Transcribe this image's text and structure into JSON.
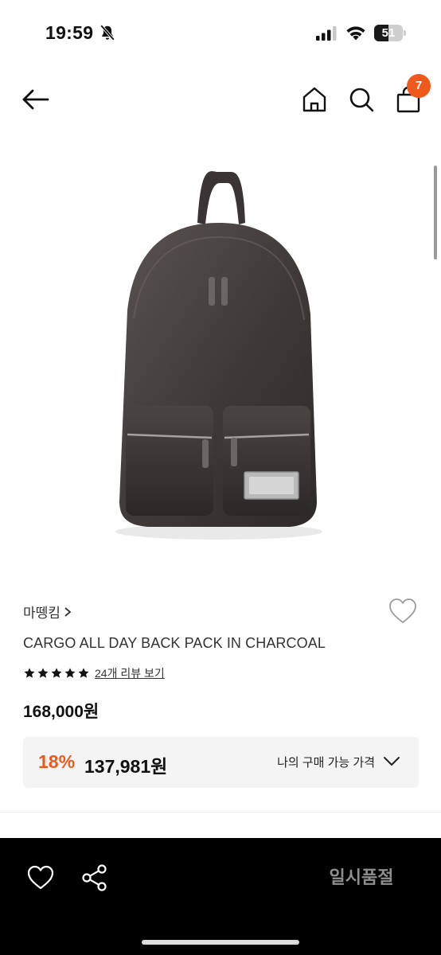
{
  "status_bar": {
    "time": "19:59",
    "battery": "51",
    "battery_level": 0.51
  },
  "nav": {
    "cart_count": "7"
  },
  "product": {
    "brand": "마뗑킴",
    "name": "CARGO ALL DAY BACK PACK IN CHARCOAL",
    "rating": 5,
    "review_link": "24개 리뷰 보기",
    "original_price": "168,000원",
    "discount_rate": "18%",
    "discount_price": "137,981원",
    "my_price_label": "나의 구매 가능 가격"
  },
  "bottom_bar": {
    "soldout_label": "일시품절"
  },
  "icons": {
    "back": "arrow-left-icon",
    "home": "home-icon",
    "search": "search-icon",
    "bag": "shopping-bag-icon",
    "wish": "heart-outline-icon",
    "share": "share-icon",
    "rating": "star-icon",
    "dropdown": "chevron-down-icon"
  },
  "colors": {
    "accent": "#ef5a1c",
    "bottom_bar": "#000000",
    "soldout_text": "#8e8e8e"
  }
}
